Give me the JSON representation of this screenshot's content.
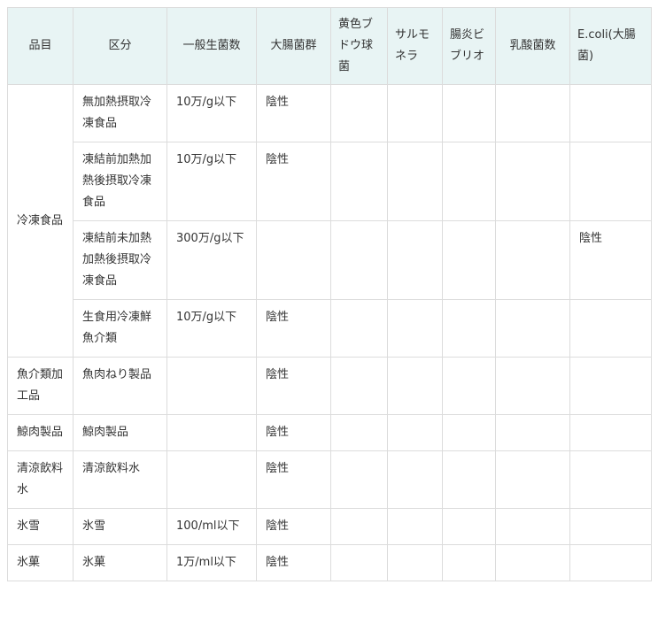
{
  "table": {
    "headers": [
      "品目",
      "区分",
      "一般生菌数",
      "大腸菌群",
      "黄色ブドウ球菌",
      "サルモネラ",
      "腸炎ビブリオ",
      "乳酸菌数",
      "E.coli(大腸菌)"
    ],
    "groups": [
      {
        "item": "冷凍食品",
        "rows": [
          [
            "無加熱摂取冷凍食品",
            "10万/g以下",
            "陰性",
            "",
            "",
            "",
            "",
            ""
          ],
          [
            "凍結前加熱加熱後摂取冷凍食品",
            "10万/g以下",
            "陰性",
            "",
            "",
            "",
            "",
            ""
          ],
          [
            "凍結前未加熱加熱後摂取冷凍食品",
            "300万/g以下",
            "",
            "",
            "",
            "",
            "",
            "陰性"
          ],
          [
            "生食用冷凍鮮魚介類",
            "10万/g以下",
            "陰性",
            "",
            "",
            "",
            "",
            ""
          ]
        ]
      },
      {
        "item": "魚介類加工品",
        "rows": [
          [
            "魚肉ねり製品",
            "",
            "陰性",
            "",
            "",
            "",
            "",
            ""
          ]
        ]
      },
      {
        "item": "鯨肉製品",
        "rows": [
          [
            "鯨肉製品",
            "",
            "陰性",
            "",
            "",
            "",
            "",
            ""
          ]
        ]
      },
      {
        "item": "清涼飲料水",
        "rows": [
          [
            "清涼飲料水",
            "",
            "陰性",
            "",
            "",
            "",
            "",
            ""
          ]
        ]
      },
      {
        "item": "氷雪",
        "rows": [
          [
            "氷雪",
            "100/ml以下",
            "陰性",
            "",
            "",
            "",
            "",
            ""
          ]
        ]
      },
      {
        "item": "氷菓",
        "rows": [
          [
            "氷菓",
            "1万/ml以下",
            "陰性",
            "",
            "",
            "",
            "",
            ""
          ]
        ]
      }
    ]
  }
}
